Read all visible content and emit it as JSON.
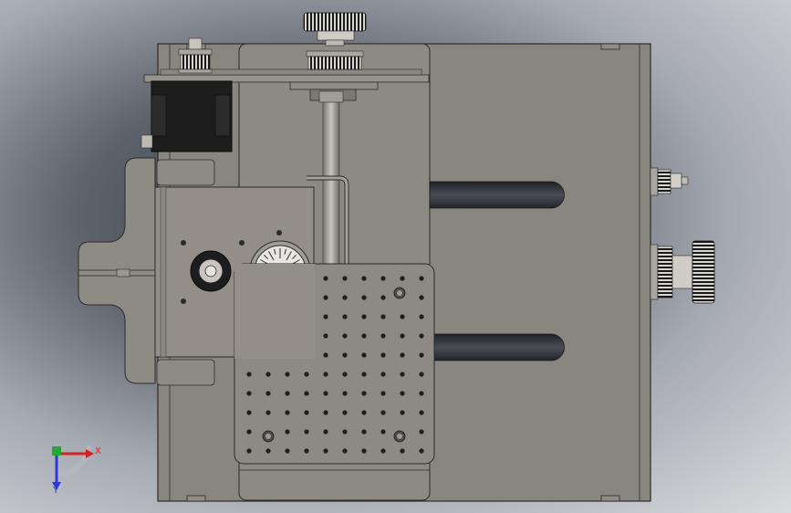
{
  "view": {
    "background_dark": "#3b3e46",
    "background_light": "#d9dbde",
    "part_fill": "#898680",
    "part_fill_light": "#938f88",
    "edge_color": "#2c2b29",
    "motor_color": "#1d1d1d",
    "slot_color": "#2d2f35"
  },
  "triad": {
    "x_label": "X",
    "y_label": "Y",
    "x_color": "#d32222",
    "y_color": "#2b3ad8",
    "z_color": "#27a836"
  },
  "icons": {
    "motor": "stepper-motor-icon",
    "pulley": "timing-pulley-icon",
    "knob": "knurled-knob-icon"
  }
}
